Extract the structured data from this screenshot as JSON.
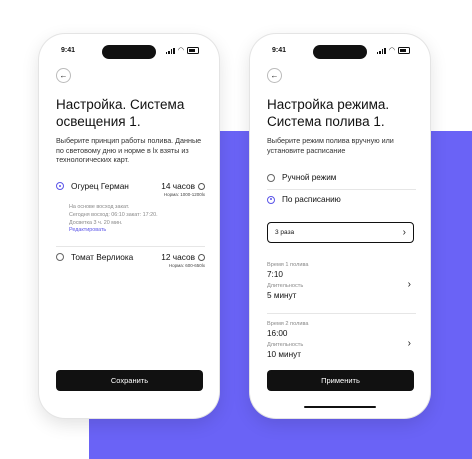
{
  "status": {
    "time": "9:41"
  },
  "lighting_screen": {
    "title": "Настройка. Система освещения 1.",
    "subtitle": "Выберите принцип работы полива. Данные по световому дню и норме в lx взяты из технологических карт.",
    "plants": [
      {
        "name": "Огурец Герман",
        "hours": "14 часов",
        "norm": "Норма: 1000-1200lx",
        "selected": true,
        "details": [
          "На основе восход закат.",
          "Сегодня восход: 06:10 закат: 17:20.",
          "Досветка 3 ч. 20 мин."
        ],
        "edit_label": "Редактировать"
      },
      {
        "name": "Томат Верлиока",
        "hours": "12 часов",
        "norm": "Норма: 600-650lx",
        "selected": false
      }
    ],
    "save_label": "Сохранить"
  },
  "watering_screen": {
    "title": "Настройка режима. Система полива 1.",
    "subtitle": "Выберите режим полива вручную или установите расписание",
    "modes": [
      {
        "label": "Ручной режим",
        "selected": false
      },
      {
        "label": "По расписанию",
        "selected": true
      }
    ],
    "count_select": "3 раза",
    "slots": [
      {
        "time_label": "Время 1 полива",
        "time": "7:10",
        "duration_label": "Длительность",
        "duration": "5 минут"
      },
      {
        "time_label": "Время 2 полива",
        "time": "16:00",
        "duration_label": "Длительность",
        "duration": "10 минут"
      }
    ],
    "apply_label": "Применить"
  },
  "icons": {
    "back": "arrow-left-icon",
    "info": "info-icon",
    "chevron": "chevron-right-icon"
  },
  "colors": {
    "accent": "#6a63f6",
    "radio_active": "#5b55e8",
    "button": "#111111"
  }
}
